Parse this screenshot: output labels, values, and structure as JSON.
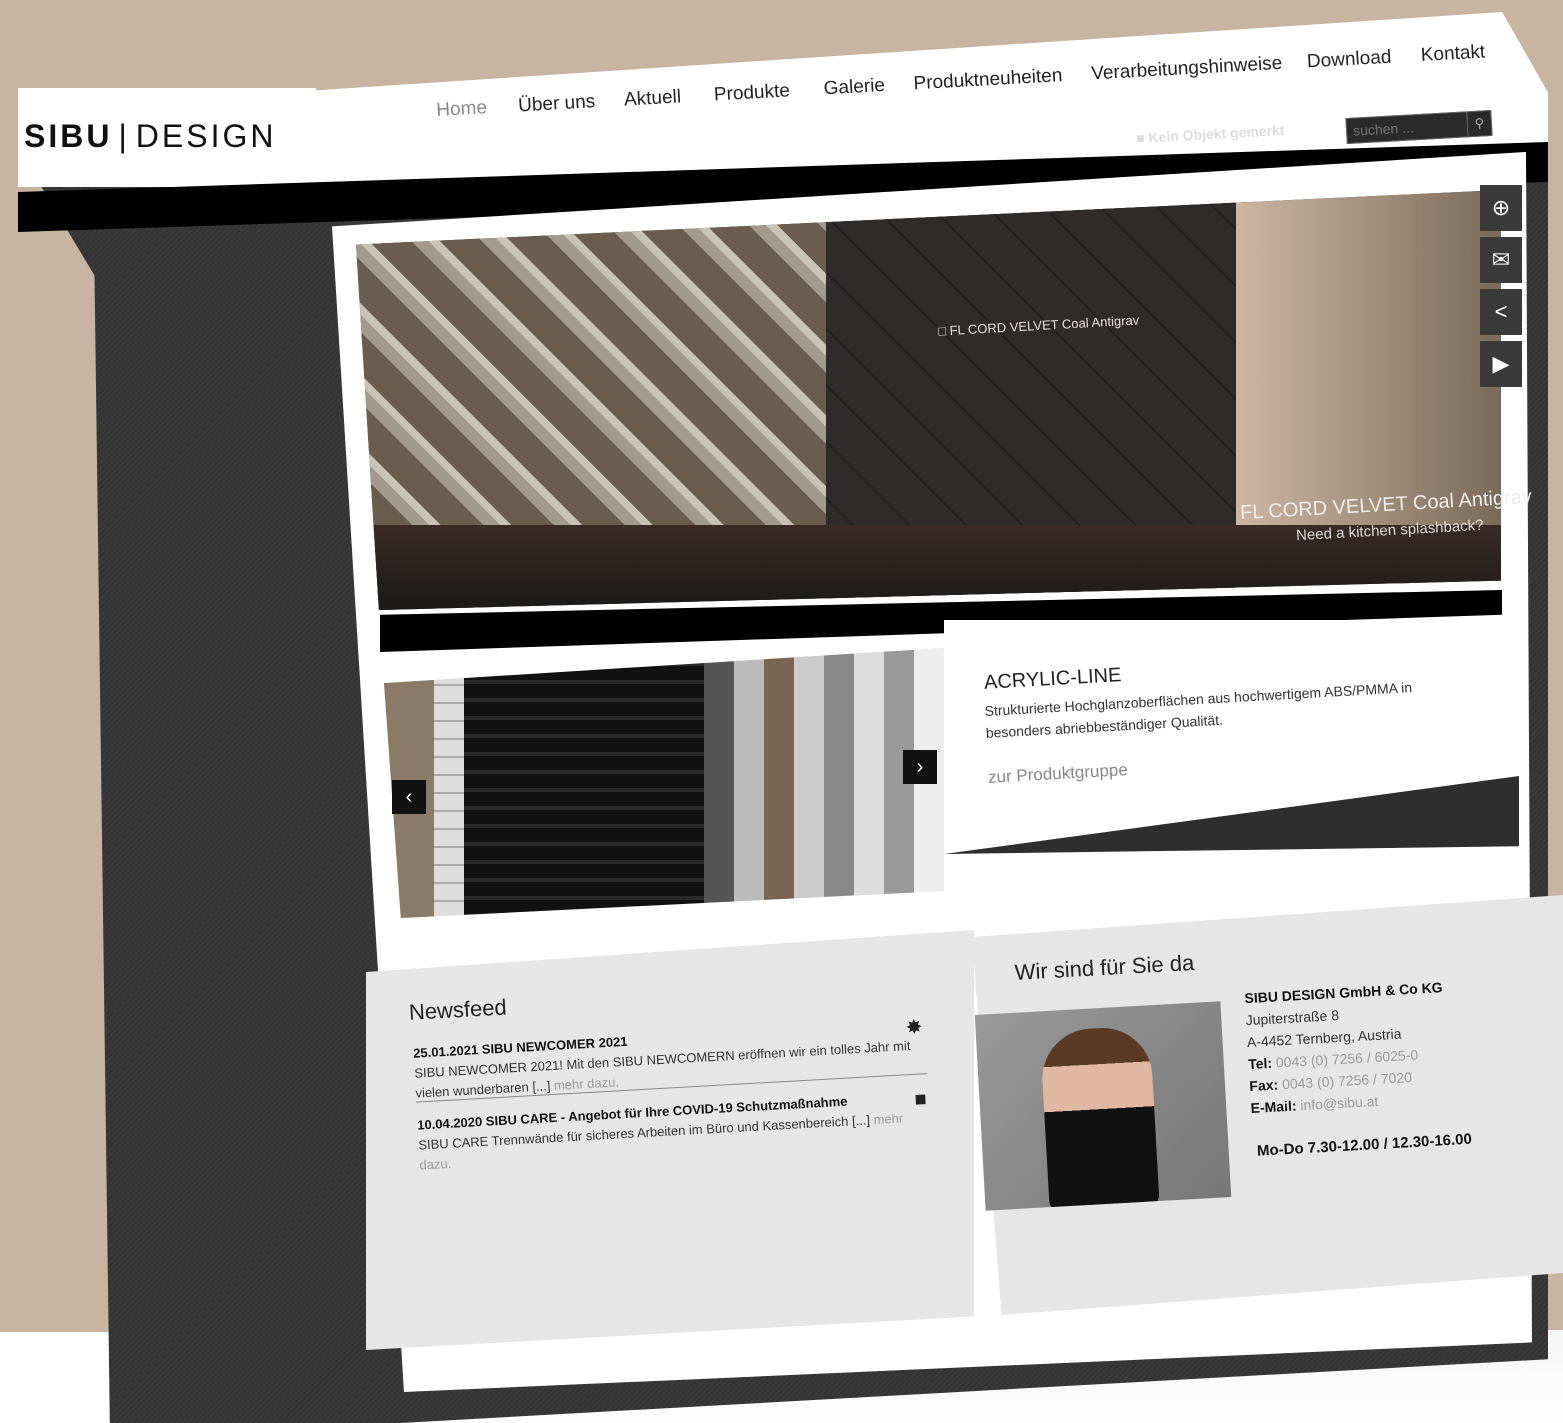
{
  "brand": {
    "part1": "SIBU",
    "separator": "|",
    "part2": "DESIGN"
  },
  "nav": {
    "items": [
      {
        "label": "Home",
        "active": true
      },
      {
        "label": "Über uns"
      },
      {
        "label": "Aktuell"
      },
      {
        "label": "Produkte"
      },
      {
        "label": "Galerie"
      },
      {
        "label": "Produktneuheiten"
      },
      {
        "label": "Verarbeitungshinweise"
      },
      {
        "label": "Download"
      },
      {
        "label": "Kontakt"
      }
    ]
  },
  "utility": {
    "merkliste": "Kein Objekt gemerkt",
    "search_placeholder": "suchen ..."
  },
  "hero": {
    "product_label": "FL CORD VELVET Coal Antigrav",
    "caption": "FL CORD VELVET Coal Antigrav",
    "subcaption": "Need a kitchen splashback?"
  },
  "side_tabs": [
    "plus-icon",
    "mail-icon",
    "share-icon",
    "play-icon"
  ],
  "acrylic": {
    "title": "ACRYLIC-LINE",
    "text": "Strukturierte Hochglanzoberflächen aus hochwertigem ABS/PMMA in besonders abriebbeständiger Qualität.",
    "link": "zur Produktgruppe"
  },
  "news": {
    "title": "Newsfeed",
    "items": [
      {
        "date": "25.01.2021 SIBU NEWCOMER 2021",
        "text": "SIBU NEWCOMER 2021! Mit den SIBU NEWCOMERN eröffnen wir ein tolles Jahr mit vielen wunderbaren [...]",
        "more": "mehr dazu."
      },
      {
        "date": "10.04.2020 SIBU CARE - Angebot für Ihre COVID-19 Schutzmaßnahme",
        "text": "SIBU CARE Trennwände für sicheres Arbeiten im Büro und Kassenbereich [...]",
        "more": "mehr dazu."
      }
    ]
  },
  "contact": {
    "title": "Wir sind für Sie da",
    "company": "SIBU DESIGN GmbH & Co KG",
    "street": "Jupiterstraße 8",
    "city": "A-4452 Ternberg, Austria",
    "tel_label": "Tel:",
    "tel": "0043 (0) 7256 / 6025-0",
    "fax_label": "Fax:",
    "fax": "0043 (0) 7256 / 7020",
    "email_label": "E-Mail:",
    "email": "info@sibu.at",
    "hours": "Mo-Do 7.30-12.00 / 12.30-16.00"
  }
}
